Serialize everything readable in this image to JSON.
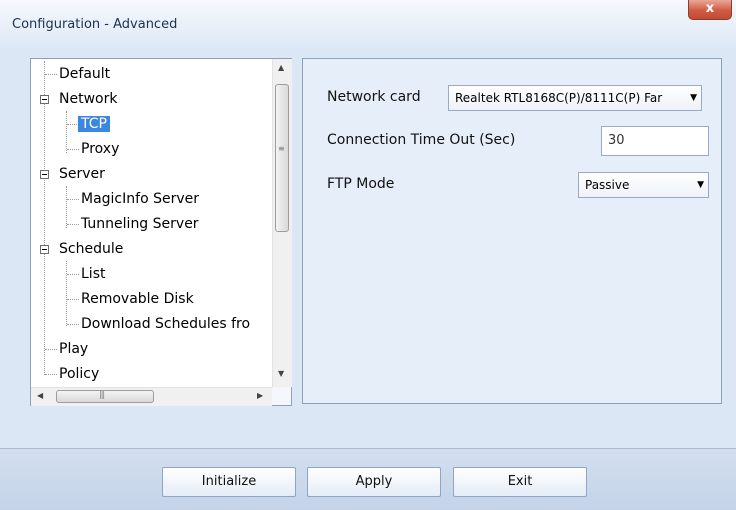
{
  "window": {
    "title": "Configuration - Advanced",
    "close_label": "x"
  },
  "tree": {
    "items": [
      {
        "label": "Default"
      },
      {
        "label": "Network"
      },
      {
        "label": "TCP"
      },
      {
        "label": "Proxy"
      },
      {
        "label": "Server"
      },
      {
        "label": "MagicInfo Server"
      },
      {
        "label": "Tunneling Server"
      },
      {
        "label": "Schedule"
      },
      {
        "label": "List"
      },
      {
        "label": "Removable Disk"
      },
      {
        "label": "Download Schedules fro"
      },
      {
        "label": "Play"
      },
      {
        "label": "Policy"
      }
    ]
  },
  "settings": {
    "network_card": {
      "label": "Network card",
      "value": "Realtek RTL8168C(P)/8111C(P) Far"
    },
    "timeout": {
      "label": "Connection Time Out (Sec)",
      "value": "30"
    },
    "ftp_mode": {
      "label": "FTP Mode",
      "value": "Passive"
    }
  },
  "footer": {
    "initialize_label": "Initialize",
    "apply_label": "Apply",
    "exit_label": "Exit"
  },
  "colors": {
    "selection": "#3a86e0",
    "panel_background": "#e6eefa",
    "footer_background": "#c4d3e8"
  },
  "icons": {
    "close": "close-icon",
    "expand_collapse": "collapse-box-icon",
    "scroll_up": "arrow-up-icon",
    "scroll_down": "arrow-down-icon",
    "scroll_left": "arrow-left-icon",
    "scroll_right": "arrow-right-icon",
    "dropdown": "chevron-down-icon"
  }
}
